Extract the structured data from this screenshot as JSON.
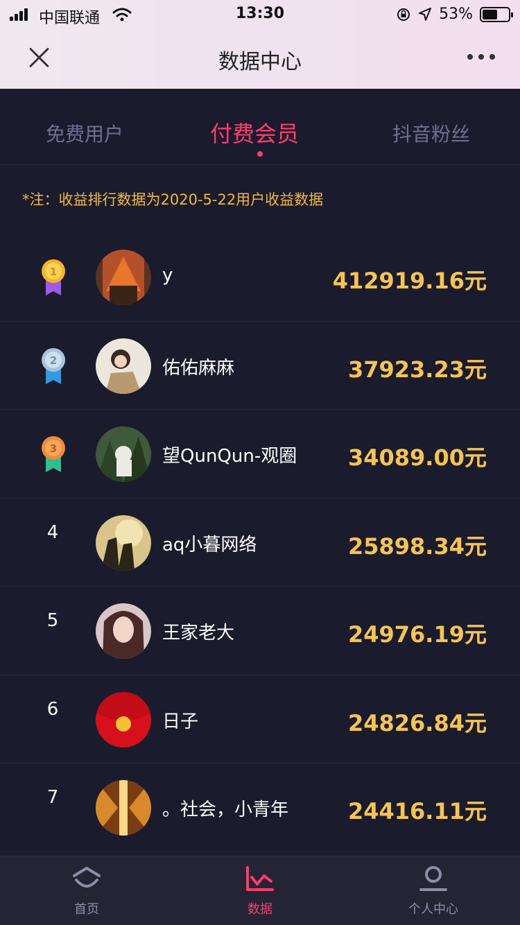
{
  "status_bar": {
    "carrier": "中国联通",
    "time": "13:30",
    "battery_text": "53%",
    "battery_level": 0.53
  },
  "nav": {
    "title": "数据中心"
  },
  "tabs": [
    {
      "label": "免费用户",
      "active": false
    },
    {
      "label": "付费会员",
      "active": true
    },
    {
      "label": "抖音粉丝",
      "active": false
    }
  ],
  "note": "*注：收益排行数据为2020-5-22用户收益数据",
  "rankings": [
    {
      "rank": "1",
      "name": "y",
      "amount": "412919.16元"
    },
    {
      "rank": "2",
      "name": "佑佑麻麻",
      "amount": "37923.23元"
    },
    {
      "rank": "3",
      "name": "望QunQun-观圈",
      "amount": "34089.00元"
    },
    {
      "rank": "4",
      "name": "aq小暮网络",
      "amount": "25898.34元"
    },
    {
      "rank": "5",
      "name": "王家老大",
      "amount": "24976.19元"
    },
    {
      "rank": "6",
      "name": "日子",
      "amount": "24826.84元"
    },
    {
      "rank": "7",
      "name": "。社会，小青年",
      "amount": "24416.11元"
    }
  ],
  "bottom_nav": [
    {
      "label": "首页",
      "icon": "home-icon",
      "active": false
    },
    {
      "label": "数据",
      "icon": "chart-icon",
      "active": true
    },
    {
      "label": "个人中心",
      "icon": "profile-icon",
      "active": false
    }
  ],
  "colors": {
    "accent": "#ff3c6e",
    "amount": "#f7c452",
    "note": "#f4b93c",
    "background": "#1b1b2e"
  }
}
